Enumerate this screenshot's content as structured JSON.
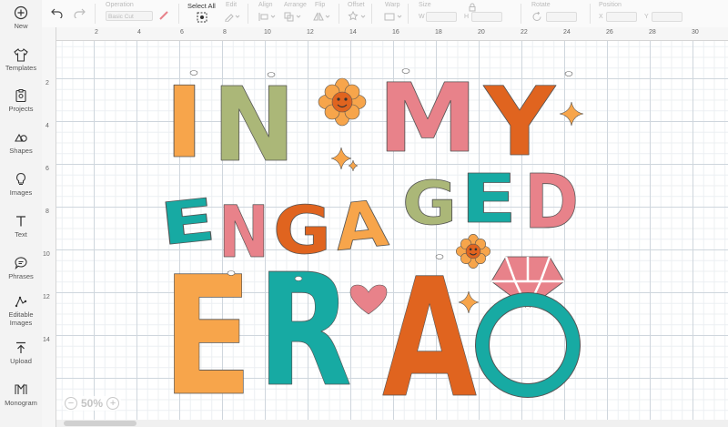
{
  "sidebar": {
    "items": [
      {
        "label": "New",
        "icon": "plus-circle-icon"
      },
      {
        "label": "Templates",
        "icon": "shirt-icon"
      },
      {
        "label": "Projects",
        "icon": "clipboard-icon"
      },
      {
        "label": "Shapes",
        "icon": "shapes-icon"
      },
      {
        "label": "Images",
        "icon": "lightbulb-icon"
      },
      {
        "label": "Text",
        "icon": "text-t-icon"
      },
      {
        "label": "Phrases",
        "icon": "speech-bubble-icon"
      },
      {
        "label": "Editable Images",
        "icon": "editable-image-icon"
      },
      {
        "label": "Upload",
        "icon": "upload-arrow-icon"
      },
      {
        "label": "Monogram",
        "icon": "monogram-icon"
      }
    ]
  },
  "toolbar": {
    "operation_label": "Operation",
    "operation_value": "Basic Cut",
    "select_all_label": "Select All",
    "edit_label": "Edit",
    "align_label": "Align",
    "arrange_label": "Arrange",
    "flip_label": "Flip",
    "offset_label": "Offset",
    "warp_label": "Warp",
    "size_label": "Size",
    "size_w": "W",
    "size_h": "H",
    "rotate_label": "Rotate",
    "position_label": "Position",
    "position_x": "X",
    "position_y": "Y"
  },
  "ruler": {
    "top": [
      "2",
      "4",
      "6",
      "8",
      "10",
      "12",
      "14",
      "16",
      "18",
      "20",
      "22",
      "24",
      "26",
      "28",
      "30"
    ],
    "left": [
      "2",
      "4",
      "6",
      "8",
      "10",
      "12",
      "14"
    ]
  },
  "design": {
    "lines": [
      "IN MY",
      "ENGAGED",
      "ERA"
    ],
    "colors": {
      "orange": "#f7a54b",
      "olive": "#abb778",
      "pink": "#e8828a",
      "rust": "#e0641f",
      "teal": "#17aaa3",
      "ring_pink": "#e8828a",
      "ring_teal": "#17aaa3",
      "flower": "#f7a54b",
      "face": "#e0641f"
    }
  },
  "zoom": {
    "value": "50%",
    "minus": "−",
    "plus": "+"
  }
}
